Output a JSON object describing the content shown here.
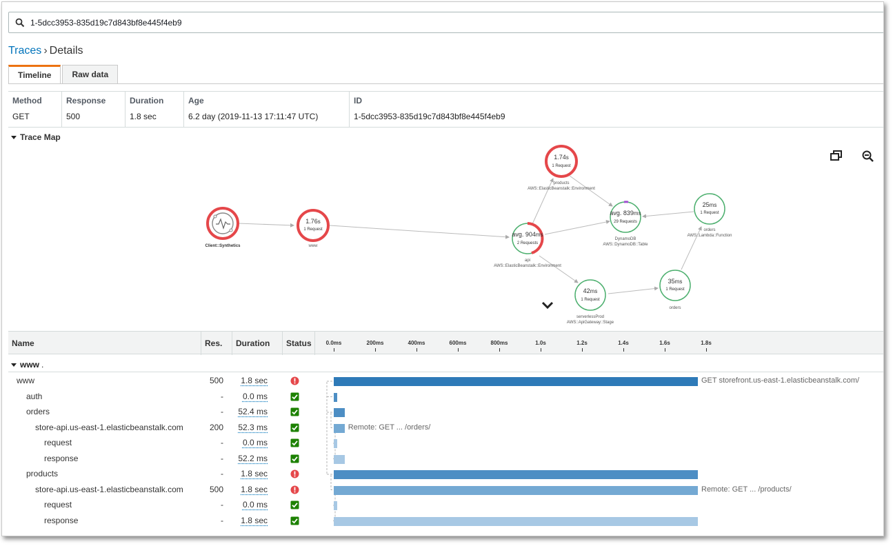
{
  "search": {
    "value": "1-5dcc3953-835d19c7d843bf8e445f4eb9"
  },
  "breadcrumb": {
    "parent": "Traces",
    "separator": "›",
    "current": "Details"
  },
  "tabs": [
    {
      "label": "Timeline",
      "active": true
    },
    {
      "label": "Raw data",
      "active": false
    }
  ],
  "summary": {
    "headers": [
      "Method",
      "Response",
      "Duration",
      "Age",
      "ID"
    ],
    "values": [
      "GET",
      "500",
      "1.8 sec",
      "6.2 day (2019-11-13 17:11:47 UTC)",
      "1-5dcc3953-835d19c7d843bf8e445f4eb9"
    ]
  },
  "trace_map": {
    "title": "Trace Map",
    "nodes": [
      {
        "id": "client",
        "label": "Client::Synthetics",
        "type": "",
        "value": "",
        "unit": "",
        "requests": "",
        "status": "error"
      },
      {
        "id": "www",
        "label": "www",
        "type": "",
        "value": "1.76",
        "unit": "s",
        "requests": "1 Request",
        "status": "error"
      },
      {
        "id": "api",
        "label": "api",
        "type": "AWS::ElasticBeanstalk::Environment",
        "value": "avg. 904",
        "unit": "ms",
        "requests": "2 Requests",
        "status": "partial-error"
      },
      {
        "id": "products",
        "label": "products",
        "type": "AWS::ElasticBeanstalk::Environment",
        "value": "1.74",
        "unit": "s",
        "requests": "1 Request",
        "status": "error"
      },
      {
        "id": "dynamodb",
        "label": "DynamoDB",
        "type": "AWS::DynamoDB::Table",
        "value": "avg. 839",
        "unit": "ms",
        "requests": "29 Requests",
        "status": "ok"
      },
      {
        "id": "orders-fn",
        "label": "orders",
        "type": "AWS::Lambda::Function",
        "value": "25",
        "unit": "ms",
        "requests": "1 Request",
        "status": "ok"
      },
      {
        "id": "orders",
        "label": "orders",
        "type": "",
        "value": "35",
        "unit": "ms",
        "requests": "1 Request",
        "status": "ok"
      },
      {
        "id": "gateway",
        "label": "serverlessProd",
        "type": "AWS::ApiGateway::Stage",
        "value": "42",
        "unit": "ms",
        "requests": "1 Request",
        "status": "ok"
      }
    ]
  },
  "timeline": {
    "headers": {
      "name": "Name",
      "res": "Res.",
      "duration": "Duration",
      "status": "Status"
    },
    "ticks": [
      "0.0ms",
      "200ms",
      "400ms",
      "600ms",
      "800ms",
      "1.0s",
      "1.2s",
      "1.4s",
      "1.6s",
      "1.8s"
    ],
    "group": {
      "label": "www",
      "suffix": "."
    },
    "rows": [
      {
        "name": "www",
        "depth": 0,
        "res": "500",
        "duration": "1.8 sec",
        "status": "error",
        "start_ms": 0,
        "dur_ms": 1760,
        "label": "GET storefront.us-east-1.elasticbeanstalk.com/"
      },
      {
        "name": "auth",
        "depth": 1,
        "res": "-",
        "duration": "0.0 ms",
        "status": "ok",
        "start_ms": 0,
        "dur_ms": 0,
        "label": ""
      },
      {
        "name": "orders",
        "depth": 1,
        "res": "-",
        "duration": "52.4 ms",
        "status": "ok",
        "start_ms": 0,
        "dur_ms": 52.4,
        "label": ""
      },
      {
        "name": "store-api.us-east-1.elasticbeanstalk.com",
        "depth": 2,
        "res": "200",
        "duration": "52.3 ms",
        "status": "ok",
        "start_ms": 0,
        "dur_ms": 52.3,
        "label": "Remote: GET ... /orders/"
      },
      {
        "name": "request",
        "depth": 3,
        "res": "-",
        "duration": "0.0 ms",
        "status": "ok",
        "start_ms": 0,
        "dur_ms": 0,
        "label": ""
      },
      {
        "name": "response",
        "depth": 3,
        "res": "-",
        "duration": "52.2 ms",
        "status": "ok",
        "start_ms": 0,
        "dur_ms": 52.2,
        "label": ""
      },
      {
        "name": "products",
        "depth": 1,
        "res": "-",
        "duration": "1.8 sec",
        "status": "error",
        "start_ms": 0,
        "dur_ms": 1760,
        "label": ""
      },
      {
        "name": "store-api.us-east-1.elasticbeanstalk.com",
        "depth": 2,
        "res": "500",
        "duration": "1.8 sec",
        "status": "error",
        "start_ms": 0,
        "dur_ms": 1760,
        "label": "Remote: GET ... /products/"
      },
      {
        "name": "request",
        "depth": 3,
        "res": "-",
        "duration": "0.0 ms",
        "status": "ok",
        "start_ms": 0,
        "dur_ms": 0,
        "label": ""
      },
      {
        "name": "response",
        "depth": 3,
        "res": "-",
        "duration": "1.8 sec",
        "status": "ok",
        "start_ms": 0,
        "dur_ms": 1760,
        "label": ""
      }
    ]
  },
  "colors": {
    "accent": "#ec7211",
    "link": "#0073bb",
    "error": "#e5474a",
    "ok": "#1d8102",
    "okRing": "#4caf6e",
    "bar0": "#2e7ab8",
    "bar1": "#4d8ec4",
    "bar2": "#74a9d3",
    "bar3": "#a7c8e4"
  },
  "icons": {
    "search": "search-icon",
    "expand": "expand-icon",
    "zoom": "zoom-out-icon",
    "chevron": "chevron-down-icon",
    "error": "error-icon",
    "ok": "check-icon"
  }
}
